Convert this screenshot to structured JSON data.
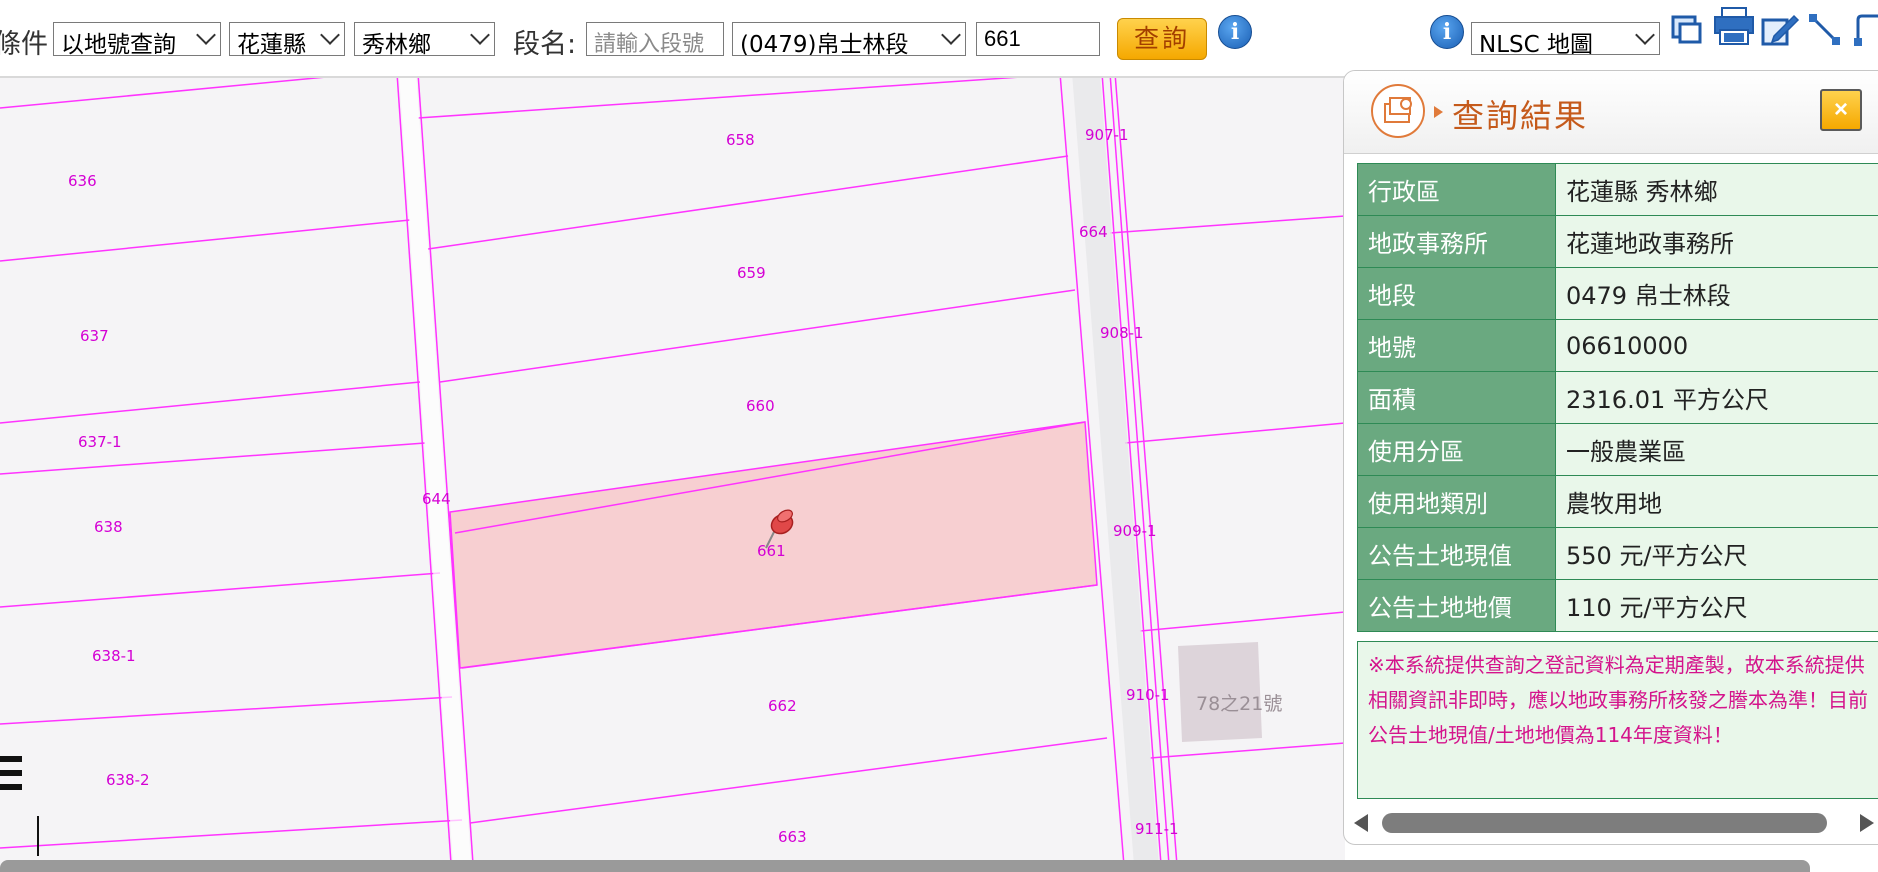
{
  "toolbar": {
    "condition_label": "條件",
    "query_mode": "以地號查詢",
    "county": "花蓮縣",
    "township": "秀林鄉",
    "section_label": "段名:",
    "section_input_placeholder": "請輸入段號",
    "section_select": "(0479)帛士林段",
    "land_no_value": "661",
    "query_button": "查詢",
    "info_icon_glyph": "i",
    "basemap_select": "NLSC 地圖"
  },
  "map": {
    "parcels": [
      {
        "no": "636"
      },
      {
        "no": "637"
      },
      {
        "no": "637-1"
      },
      {
        "no": "638"
      },
      {
        "no": "638-1"
      },
      {
        "no": "638-2"
      },
      {
        "no": "644"
      },
      {
        "no": "658"
      },
      {
        "no": "659"
      },
      {
        "no": "660"
      },
      {
        "no": "661"
      },
      {
        "no": "662"
      },
      {
        "no": "663"
      },
      {
        "no": "664"
      },
      {
        "no": "907-1"
      },
      {
        "no": "908-1"
      },
      {
        "no": "909-1"
      },
      {
        "no": "910-1"
      },
      {
        "no": "911-1"
      }
    ],
    "building_label": "78之21號",
    "selected_parcel": "661",
    "selected_fill": "#f7cfd1",
    "boundary_color": "#ff33ff",
    "pin_icon": "pushpin-icon"
  },
  "result_panel": {
    "title": "查詢結果",
    "close_glyph": "×",
    "rows": [
      {
        "key": "行政區",
        "value": "花蓮縣 秀林鄉"
      },
      {
        "key": "地政事務所",
        "value": "花蓮地政事務所"
      },
      {
        "key": "地段",
        "value": "0479 帛士林段"
      },
      {
        "key": "地號",
        "value": "06610000"
      },
      {
        "key": "面積",
        "value": "2316.01 平方公尺"
      },
      {
        "key": "使用分區",
        "value": "一般農業區"
      },
      {
        "key": "使用地類別",
        "value": "農牧用地"
      },
      {
        "key": "公告土地現值",
        "value": "550 元/平方公尺"
      },
      {
        "key": "公告土地地價",
        "value": "110 元/平方公尺"
      }
    ],
    "note": "※本系統提供查詢之登記資料為定期產製，故本系統提供相關資訊非即時，應以地政事務所核發之謄本為準！目前公告土地現值/土地地價為114年度資料！"
  },
  "colors": {
    "accent_orange": "#f5a800",
    "table_header_green": "#6aa980",
    "table_value_green": "#e9f7ea",
    "note_text": "#d4148c"
  }
}
